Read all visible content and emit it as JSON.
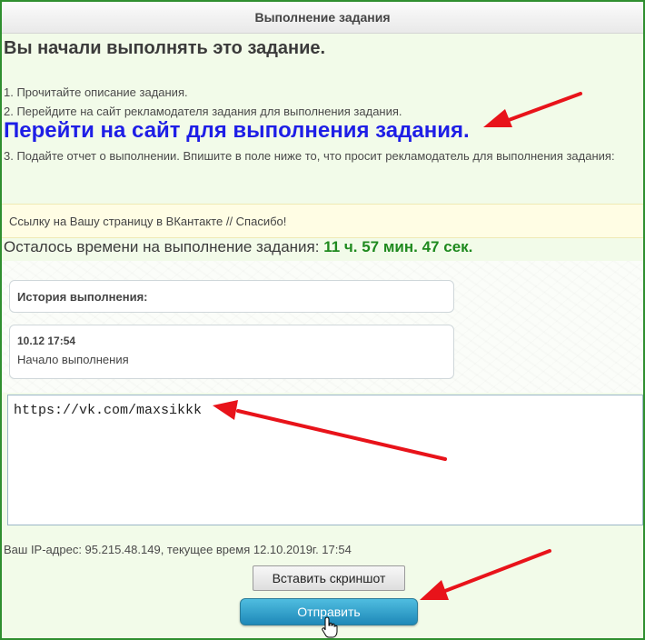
{
  "window": {
    "title": "Выполнение задания"
  },
  "heading": "Вы начали выполнять это задание.",
  "steps": {
    "step1": "1. Прочитайте описание задания.",
    "step2": "2. Перейдите на сайт рекламодателя задания для выполнения задания.",
    "link": "Перейти на сайт для выполнения задания.",
    "step3": "3. Подайте отчет о выполнении. Впишите в поле ниже то, что просит рекламодатель для выполнения задания:"
  },
  "request_text": "Ссылку на Вашу страницу в ВКантакте // Спасибо!",
  "timer": {
    "label": "Осталось времени на выполнение задания:",
    "value": "11 ч. 57 мин. 47 сек."
  },
  "history": {
    "title": "История выполнения:",
    "entries": [
      {
        "timestamp": "10.12 17:54",
        "text": "Начало выполнения"
      }
    ]
  },
  "answer": {
    "value": "https://vk.com/maxsikkk"
  },
  "ip_line": "Ваш IP-адрес: 95.215.48.149, текущее время 12.10.2019г. 17:54",
  "buttons": {
    "screenshot": "Вставить скриншот",
    "submit": "Отправить"
  },
  "colors": {
    "border": "#2f8f2f",
    "link": "#1e1ee6",
    "timer": "#1f8a1f",
    "arrow": "#e8131a",
    "submit": "#1e88b8"
  }
}
